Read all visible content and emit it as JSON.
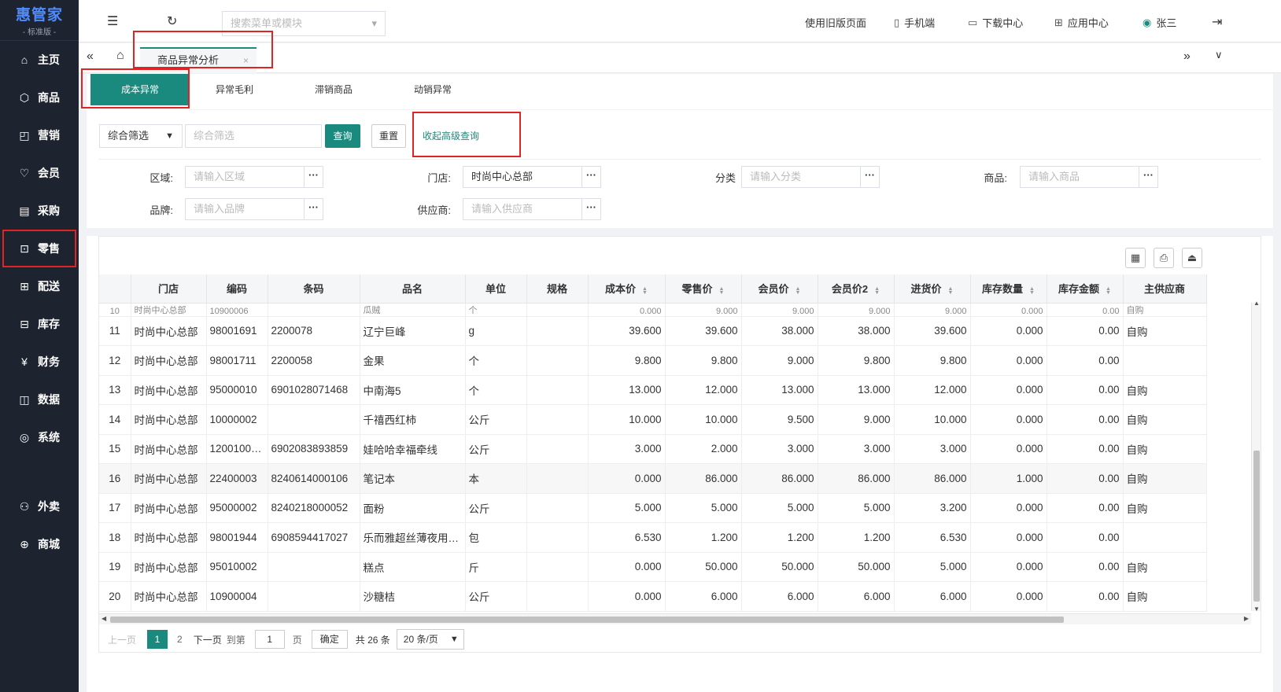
{
  "logo": {
    "title": "惠管家",
    "subtitle": "- 标准版 -"
  },
  "sidebar": [
    {
      "label": "主页",
      "icon": "home-icon",
      "glyph": "⌂"
    },
    {
      "label": "商品",
      "icon": "box-icon",
      "glyph": "⬡"
    },
    {
      "label": "营销",
      "icon": "chart-icon",
      "glyph": "◰"
    },
    {
      "label": "会员",
      "icon": "member-icon",
      "glyph": "♡"
    },
    {
      "label": "采购",
      "icon": "purchase-icon",
      "glyph": "▤"
    },
    {
      "label": "零售",
      "icon": "bag-icon",
      "glyph": "⊡"
    },
    {
      "label": "配送",
      "icon": "delivery-icon",
      "glyph": "⊞"
    },
    {
      "label": "库存",
      "icon": "inventory-icon",
      "glyph": "⊟"
    },
    {
      "label": "财务",
      "icon": "finance-icon",
      "glyph": "¥"
    },
    {
      "label": "数据",
      "icon": "data-icon",
      "glyph": "◫"
    },
    {
      "label": "系统",
      "icon": "settings-icon",
      "glyph": "◎"
    },
    {
      "label": "外卖",
      "icon": "takeout-icon",
      "glyph": "⚇"
    },
    {
      "label": "商城",
      "icon": "mall-icon",
      "glyph": "⊕"
    }
  ],
  "topbar": {
    "search_placeholder": "搜索菜单或模块",
    "old_page": "使用旧版页面",
    "mobile": "手机端",
    "download": "下载中心",
    "apps": "应用中心",
    "user": "张三"
  },
  "tabbar": {
    "page_tab": "商品异常分析"
  },
  "subtabs": [
    "成本异常",
    "异常毛利",
    "滞销商品",
    "动销异常"
  ],
  "filter": {
    "select": "综合筛选",
    "input_placeholder": "综合筛选",
    "query": "查询",
    "reset": "重置",
    "advanced": "收起高级查询"
  },
  "fields": {
    "region_label": "区域:",
    "region_ph": "请输入区域",
    "store_label": "门店:",
    "store_val": "时尚中心总部",
    "category_label": "分类",
    "category_ph": "请输入分类",
    "product_label": "商品:",
    "product_ph": "请输入商品",
    "brand_label": "品牌:",
    "brand_ph": "请输入品牌",
    "supplier_label": "供应商:",
    "supplier_ph": "请输入供应商"
  },
  "table": {
    "headers": [
      "",
      "门店",
      "编码",
      "条码",
      "品名",
      "单位",
      "规格",
      "成本价",
      "零售价",
      "会员价",
      "会员价2",
      "进货价",
      "库存数量",
      "库存金额",
      "主供应商"
    ],
    "partial_row": [
      "10",
      "时尚中心总部",
      "10900006",
      "",
      "瓜贼",
      "个",
      "",
      "0.000",
      "9.000",
      "9.000",
      "9.000",
      "9.000",
      "0.000",
      "0.00",
      "自购"
    ],
    "rows": [
      [
        "11",
        "时尚中心总部",
        "98001691",
        "2200078",
        "辽宁巨峰",
        "g",
        "",
        "39.600",
        "39.600",
        "38.000",
        "38.000",
        "39.600",
        "0.000",
        "0.00",
        "自购"
      ],
      [
        "12",
        "时尚中心总部",
        "98001711",
        "2200058",
        "金果",
        "个",
        "",
        "9.800",
        "9.800",
        "9.000",
        "9.800",
        "9.800",
        "0.000",
        "0.00",
        ""
      ],
      [
        "13",
        "时尚中心总部",
        "95000010",
        "6901028071468",
        "中南海5",
        "个",
        "",
        "13.000",
        "12.000",
        "13.000",
        "13.000",
        "12.000",
        "0.000",
        "0.00",
        "自购"
      ],
      [
        "14",
        "时尚中心总部",
        "10000002",
        "",
        "千禧西红柿",
        "公斤",
        "",
        "10.000",
        "10.000",
        "9.500",
        "9.000",
        "10.000",
        "0.000",
        "0.00",
        "自购"
      ],
      [
        "15",
        "时尚中心总部",
        "1200100…",
        "6902083893859",
        "娃哈哈幸福牵线",
        "公斤",
        "",
        "3.000",
        "2.000",
        "3.000",
        "3.000",
        "3.000",
        "0.000",
        "0.00",
        "自购"
      ],
      [
        "16",
        "时尚中心总部",
        "22400003",
        "8240614000106",
        "笔记本",
        "本",
        "",
        "0.000",
        "86.000",
        "86.000",
        "86.000",
        "86.000",
        "1.000",
        "0.00",
        "自购"
      ],
      [
        "17",
        "时尚中心总部",
        "95000002",
        "8240218000052",
        "面粉",
        "公斤",
        "",
        "5.000",
        "5.000",
        "5.000",
        "5.000",
        "3.200",
        "0.000",
        "0.00",
        "自购"
      ],
      [
        "18",
        "时尚中心总部",
        "98001944",
        "6908594417027",
        "乐而雅超丝薄夜用…",
        "包",
        "",
        "6.530",
        "1.200",
        "1.200",
        "1.200",
        "6.530",
        "0.000",
        "0.00",
        ""
      ],
      [
        "19",
        "时尚中心总部",
        "95010002",
        "",
        "糕点",
        "斤",
        "",
        "0.000",
        "50.000",
        "50.000",
        "50.000",
        "5.000",
        "0.000",
        "0.00",
        "自购"
      ],
      [
        "20",
        "时尚中心总部",
        "10900004",
        "",
        "沙糖桔",
        "公斤",
        "",
        "0.000",
        "6.000",
        "6.000",
        "6.000",
        "6.000",
        "0.000",
        "0.00",
        "自购"
      ]
    ]
  },
  "pager": {
    "prev": "上一页",
    "p1": "1",
    "p2": "2",
    "next": "下一页",
    "goto": "到第",
    "page_in": "1",
    "page_unit": "页",
    "confirm": "确定",
    "total": "共 26 条",
    "size": "20 条/页"
  }
}
